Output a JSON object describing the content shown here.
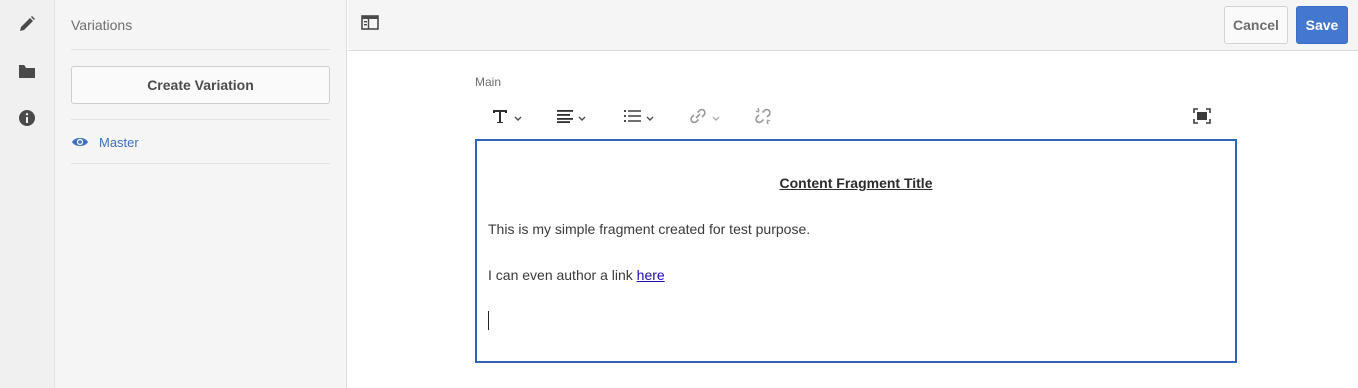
{
  "rail": {
    "items": [
      {
        "icon": "pencil-icon"
      },
      {
        "icon": "folder-icon"
      },
      {
        "icon": "info-icon"
      }
    ]
  },
  "panel": {
    "title": "Variations",
    "create_label": "Create Variation",
    "variations": [
      {
        "label": "Master",
        "icon": "eye-icon"
      }
    ]
  },
  "topbar": {
    "toggle_icon": "panel-toggle-icon",
    "cancel_label": "Cancel",
    "save_label": "Save"
  },
  "editor": {
    "field_label": "Main",
    "toolbar": [
      "text-format-icon",
      "align-icon",
      "list-icon",
      "link-icon",
      "unlink-icon",
      "fullscreen-icon"
    ],
    "title": "Content Fragment Title",
    "paragraph1": "This is my simple fragment created for test purpose.",
    "paragraph2_prefix": "I can even author a link ",
    "paragraph2_link": "here"
  },
  "colors": {
    "accent": "#4478d0",
    "link": "#3e70c0",
    "editor_border": "#2f63b6"
  }
}
